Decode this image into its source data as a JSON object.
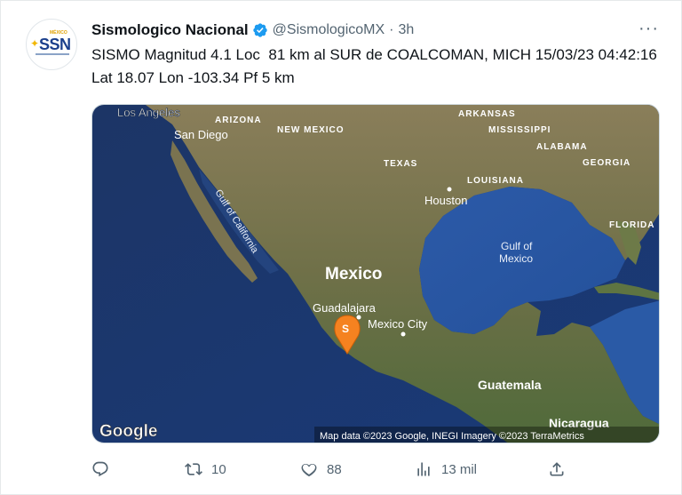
{
  "tweet": {
    "author": {
      "display_name": "Sismologico Nacional",
      "handle": "@SismologicoMX",
      "separator": "·",
      "time": "3h",
      "avatar_text": "SSN",
      "avatar_small_text": "MÉXICO",
      "verified_color": "#1d9bf0"
    },
    "text": "SISMO Magnitud 4.1 Loc  81 km al SUR de COALCOMAN, MICH 15/03/23 04:42:16 Lat 18.07 Lon -103.34 Pf 5 km",
    "more_label": "···",
    "map": {
      "labels": {
        "los_angeles": "Los Angeles",
        "arizona": "ARIZONA",
        "new_mexico": "NEW MEXICO",
        "san_diego": "San Diego",
        "arkansas": "ARKANSAS",
        "mississippi": "MISSISSIPPI",
        "alabama": "ALABAMA",
        "georgia": "GEORGIA",
        "texas": "TEXAS",
        "louisiana": "LOUISIANA",
        "houston": "Houston",
        "florida": "FLORIDA",
        "gulf_of_california": "Gulf of California",
        "gulf_of_mexico_1": "Gulf of",
        "gulf_of_mexico_2": "Mexico",
        "mexico": "Mexico",
        "guadalajara": "Guadalajara",
        "mexico_city": "Mexico City",
        "guatemala": "Guatemala",
        "nicaragua": "Nicaragua",
        "marker": "S",
        "google": "Google",
        "attribution": "Map data ©2023 Google, INEGI Imagery ©2023 TerraMetrics"
      },
      "marker_color": "#f58220",
      "ocean_color": "#1f3b6e",
      "land_color": "#7d7a52"
    },
    "actions": {
      "reply_count": "",
      "retweet_count": "10",
      "like_count": "88",
      "views_count": "13 mil",
      "share_count": ""
    }
  }
}
